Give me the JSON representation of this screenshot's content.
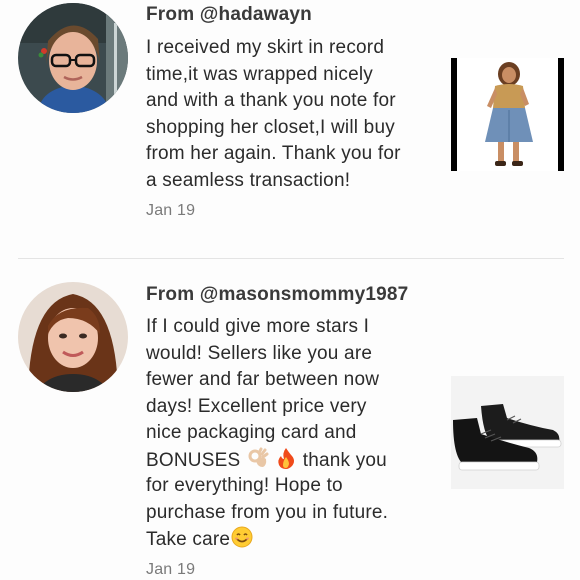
{
  "reviews": [
    {
      "from_prefix": "From ",
      "username": "@hadawayn",
      "lines": [
        "I received my skirt in record",
        "time,it was wrapped nicely",
        "and with a thank you note for",
        "shopping her closet,I will buy",
        "from her again. Thank you for",
        "a seamless transaction!"
      ],
      "date": "Jan 19",
      "avatar_icon": "person-photo-icon",
      "thumbnail_icon": "skirt-outfit-photo-icon"
    },
    {
      "from_prefix": "From ",
      "username": "@masonsmommy1987",
      "lines": [
        "If I could give more stars I",
        "would! Sellers like you are",
        "fewer and far between now",
        "days! Excellent price very",
        "nice packaging card and"
      ],
      "line6_before": "BONUSES ",
      "line6_after": " thank you",
      "lines_tail": [
        "for everything! Hope to",
        "purchase from you in future."
      ],
      "last_line": "Take care",
      "date": "Jan 19",
      "avatar_icon": "person-photo-icon",
      "thumbnail_icon": "black-sneakers-photo-icon",
      "emoji_icons": [
        "ok-hand-emoji-icon",
        "fire-emoji-icon",
        "smiling-face-emoji-icon"
      ]
    }
  ],
  "colors": {
    "username_text": "#3a3a3a",
    "body_text": "#2b2b2b",
    "date_text": "#7a7a7a",
    "divider": "#e4e4e4"
  }
}
